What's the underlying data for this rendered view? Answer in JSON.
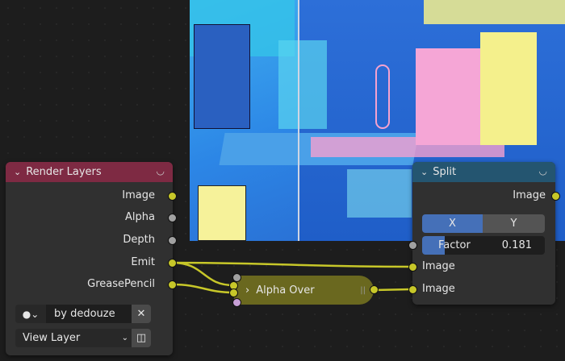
{
  "render_layers": {
    "title": "Render Layers",
    "outputs": [
      "Image",
      "Alpha",
      "Depth",
      "Emit",
      "GreasePencil"
    ],
    "scene_value": "by dedouze",
    "view_layer": "View Layer",
    "header_color": "#7e2a43"
  },
  "split": {
    "title": "Split",
    "output": "Image",
    "axis_options": [
      "X",
      "Y"
    ],
    "axis_selected": "X",
    "factor_label": "Factor",
    "factor_value": "0.181",
    "factor_fraction": 0.181,
    "inputs": [
      "Image",
      "Image"
    ],
    "header_color": "#245570"
  },
  "alpha_over": {
    "title": "Alpha Over",
    "color": "#6a681f"
  }
}
